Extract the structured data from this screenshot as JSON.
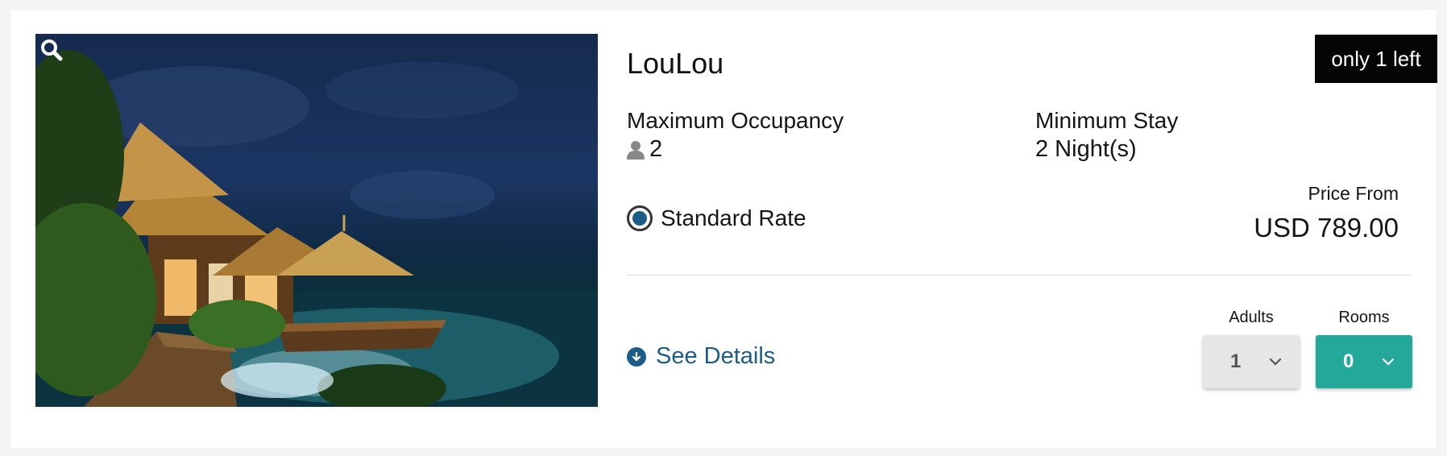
{
  "room": {
    "name": "LouLou",
    "availability_badge": "only 1 left"
  },
  "occupancy": {
    "label": "Maximum Occupancy",
    "value": "2",
    "icon": "person-icon"
  },
  "min_stay": {
    "label": "Minimum Stay",
    "value": "2 Night(s)"
  },
  "rate": {
    "label": "Standard Rate",
    "selected": true
  },
  "price": {
    "label": "Price From",
    "value": "USD 789.00"
  },
  "details": {
    "label": "See Details",
    "icon": "download-circle-icon"
  },
  "selectors": {
    "adults": {
      "label": "Adults",
      "value": "1"
    },
    "rooms": {
      "label": "Rooms",
      "value": "0"
    }
  },
  "colors": {
    "accent": "#1b5d88",
    "rooms_select": "#23a89a",
    "badge_bg": "#050505"
  }
}
